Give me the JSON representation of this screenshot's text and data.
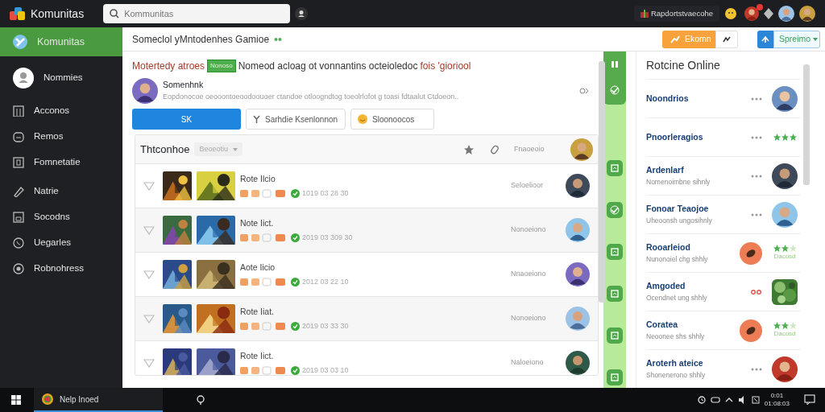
{
  "topbar": {
    "brand": "Komunitas",
    "search": {
      "placeholder": "Kommunitas"
    },
    "user_label": "Rapdortstvaecohe"
  },
  "sidebar": {
    "items": [
      {
        "label": "Komunitas",
        "selected": true
      },
      {
        "label": "Nommies",
        "selected": false
      },
      {
        "label": "Acconos",
        "selected": false
      },
      {
        "label": "Remos",
        "selected": false
      },
      {
        "label": "Fomnetatie",
        "selected": false
      },
      {
        "label": "Natrie",
        "selected": false
      },
      {
        "label": "Socodns",
        "selected": false
      },
      {
        "label": "Uegarles",
        "selected": false
      },
      {
        "label": "Robnohress",
        "selected": false
      }
    ]
  },
  "header": {
    "title": "Someclol yMntodenhes Gamioe",
    "primary_button": "Ekomn",
    "split_button": "Spreimo"
  },
  "notice": {
    "lead": "Motertedy atroes",
    "badge": "Nonoso",
    "text": "Nomeod acloag ot vonnantins octeioledoc",
    "trail": "fois 'gioriool"
  },
  "post": {
    "author": "Somenhnk",
    "text": "Eopdonocoe oeooontoeoodoouoer ctandoe otloogndtog toeolrlofot g toasi fdtaalut Ctdoeon..",
    "buttons": [
      {
        "label": "SK",
        "kind": "primary"
      },
      {
        "label": "Sarhdie Ksenlonnon",
        "kind": "filter"
      },
      {
        "label": "Sloonoocos",
        "kind": "emoji"
      }
    ]
  },
  "list": {
    "title": "Thtconhoe",
    "filter": "Beoeotiu",
    "column_label": "Fnaoeoio",
    "rows": [
      {
        "title": "Rote Ilcio",
        "date": "1019 03 28 30",
        "status": "Seloelioor"
      },
      {
        "title": "Note Iict.",
        "date": "2019 03 309 30",
        "status": "Nonoeiono"
      },
      {
        "title": "Aote Iicio",
        "date": "2012 03 22 10",
        "status": "Nnaoeiono"
      },
      {
        "title": "Rote Iiat.",
        "date": "2019 03 33 30",
        "status": "Nonoeiono"
      },
      {
        "title": "Rote Iict.",
        "date": "2019 03 03 10",
        "status": "Naloeiono"
      }
    ]
  },
  "online": {
    "title": "Rotcine Online",
    "items": [
      {
        "name": "Noondrios",
        "kind": "more"
      },
      {
        "name": "Pnoorleragios",
        "kind": "rated",
        "stars": 3
      },
      {
        "name": "Ardenlarf",
        "subtitle": "Nomenoimbne sihnly",
        "kind": "more"
      },
      {
        "name": "Fonoar Teaojoe",
        "subtitle": "Uheoonsh ungosihnly",
        "kind": "more"
      },
      {
        "name": "Rooarleiod",
        "subtitle": "Nunonoiel chg shhly",
        "kind": "badge",
        "stars": 2,
        "rating": "Dacosd"
      },
      {
        "name": "Amgoded",
        "subtitle": "Ocendnet ung shhly",
        "kind": "alert"
      },
      {
        "name": "Coratea",
        "subtitle": "Neoonee shs shhly",
        "kind": "badge",
        "stars": 2,
        "rating": "Dacosd"
      },
      {
        "name": "Aroterh ateice",
        "subtitle": "Shonenerono shhly",
        "kind": "more"
      }
    ]
  },
  "taskbar": {
    "app": "Nelp Inoed",
    "time": "0:01",
    "date": "01:08:03"
  }
}
